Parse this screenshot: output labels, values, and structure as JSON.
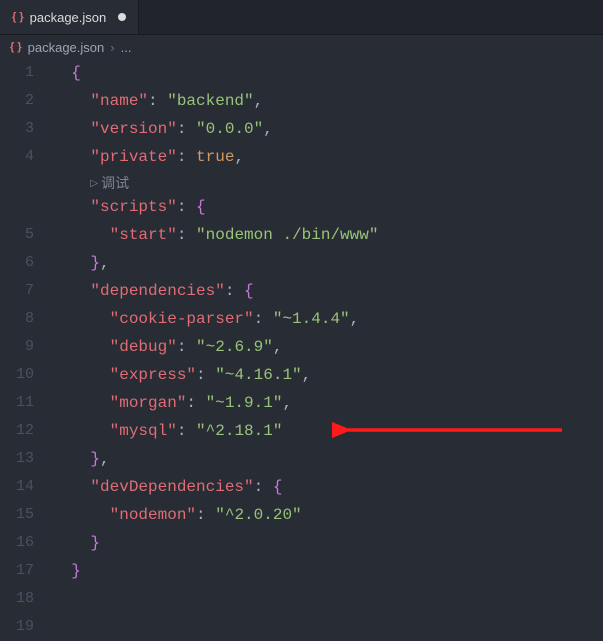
{
  "tab": {
    "filename": "package.json",
    "icon_label": "{ }"
  },
  "breadcrumb": {
    "filename": "package.json",
    "sep": "›",
    "more": "..."
  },
  "debug_lens": "调试",
  "lines": [
    {
      "n": "1"
    },
    {
      "n": "2"
    },
    {
      "n": "3"
    },
    {
      "n": "4"
    },
    {
      "n": "5"
    },
    {
      "n": "6"
    },
    {
      "n": "7"
    },
    {
      "n": "8"
    },
    {
      "n": "9"
    },
    {
      "n": "10"
    },
    {
      "n": "11"
    },
    {
      "n": "12"
    },
    {
      "n": "13"
    },
    {
      "n": "14"
    },
    {
      "n": "15"
    },
    {
      "n": "16"
    },
    {
      "n": "17"
    },
    {
      "n": "18"
    },
    {
      "n": "19"
    }
  ],
  "json": {
    "name_key": "\"name\"",
    "name_val": "\"backend\"",
    "version_key": "\"version\"",
    "version_val": "\"0.0.0\"",
    "private_key": "\"private\"",
    "private_val": "true",
    "scripts_key": "\"scripts\"",
    "start_key": "\"start\"",
    "start_val": "\"nodemon ./bin/www\"",
    "deps_key": "\"dependencies\"",
    "cookie_key": "\"cookie-parser\"",
    "cookie_val": "\"~1.4.4\"",
    "debug_key": "\"debug\"",
    "debug_val": "\"~2.6.9\"",
    "express_key": "\"express\"",
    "express_val": "\"~4.16.1\"",
    "morgan_key": "\"morgan\"",
    "morgan_val": "\"~1.9.1\"",
    "mysql_key": "\"mysql\"",
    "mysql_val": "\"^2.18.1\"",
    "devdeps_key": "\"devDependencies\"",
    "nodemon_key": "\"nodemon\"",
    "nodemon_val": "\"^2.0.20\""
  }
}
